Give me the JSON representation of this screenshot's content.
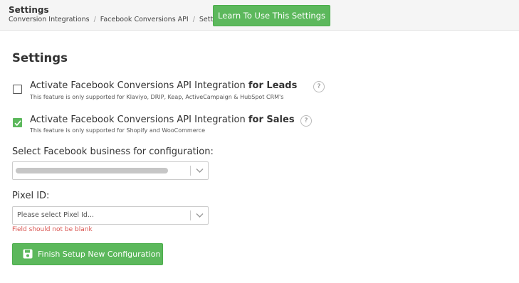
{
  "header": {
    "title": "Settings",
    "breadcrumb": [
      "Conversion Integrations",
      "Facebook Conversions API",
      "Settings"
    ],
    "breadcrumb_separator": "/",
    "learn_button": "Learn To Use This Settings"
  },
  "main": {
    "section_title": "Settings",
    "options": [
      {
        "label_prefix": "Activate Facebook Conversions API Integration",
        "label_bold": "for Leads",
        "description": "This feature is only supported for Klaviyo, DRIP, Keap, ActiveCampaign & HubSpot CRM's",
        "checked": false,
        "help": "?"
      },
      {
        "label_prefix": "Activate Facebook Conversions API Integration",
        "label_bold": "for Sales",
        "description": "This feature is only supported for Shopify and WooCommerce",
        "checked": true,
        "help": "?"
      }
    ],
    "business_select": {
      "label": "Select Facebook business for configuration:",
      "value": ""
    },
    "pixel_select": {
      "label": "Pixel ID:",
      "placeholder": "Please select Pixel Id...",
      "error": "Field should not be blank"
    },
    "finish_button": "Finish Setup New Configuration"
  },
  "colors": {
    "accent": "#5cb85c",
    "error": "#d9534f"
  },
  "icons": {
    "help": "question-icon",
    "chevron": "chevron-down-icon",
    "save": "floppy-disk-icon",
    "check": "checkmark-icon"
  }
}
